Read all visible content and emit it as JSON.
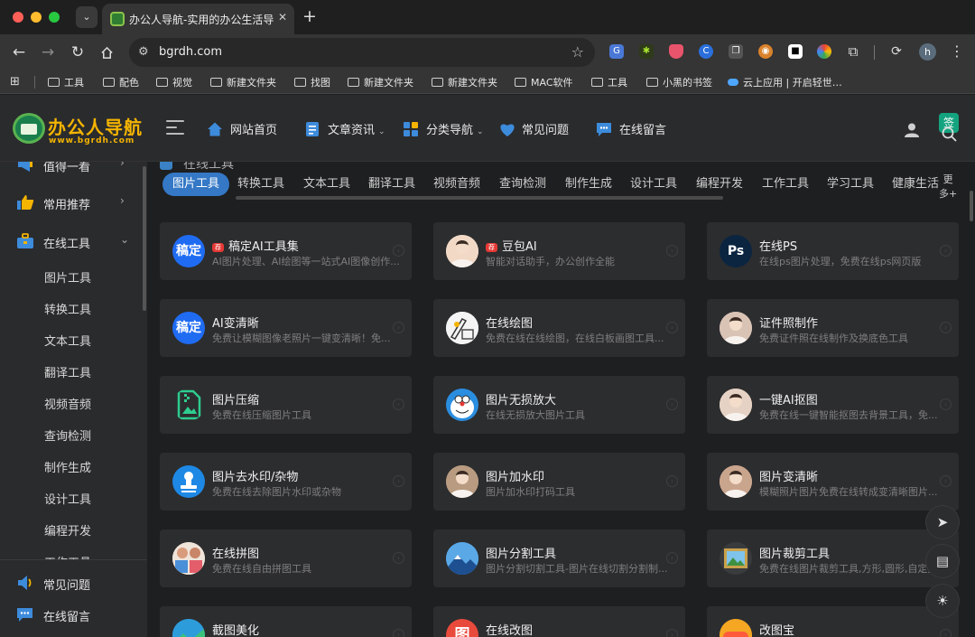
{
  "browser": {
    "tab_title": "办公人导航-实用的办公生活导航",
    "tab_close": "✕",
    "new_tab": "+",
    "url": "bgrdh.com",
    "profile_initial": "h",
    "bookmarks": [
      {
        "label": "工具",
        "kind": "folder"
      },
      {
        "label": "配色",
        "kind": "folder"
      },
      {
        "label": "视觉",
        "kind": "folder"
      },
      {
        "label": "新建文件夹",
        "kind": "folder"
      },
      {
        "label": "找图",
        "kind": "folder"
      },
      {
        "label": "新建文件夹",
        "kind": "folder"
      },
      {
        "label": "新建文件夹",
        "kind": "folder"
      },
      {
        "label": "MAC软件",
        "kind": "folder"
      },
      {
        "label": "工具",
        "kind": "folder"
      },
      {
        "label": "小黑的书签",
        "kind": "folder"
      },
      {
        "label": "云上应用 | 开启轻世…",
        "kind": "cloud"
      }
    ]
  },
  "site": {
    "logo_title": "办公人导航",
    "logo_url": "www.bgrdh.com",
    "badge_text": "签",
    "nav": [
      {
        "label": "网站首页",
        "icon": "home-icon",
        "color": "#3d8bdb",
        "caret": false
      },
      {
        "label": "文章资讯",
        "icon": "document-icon",
        "color": "#3d8bdb",
        "caret": true
      },
      {
        "label": "分类导航",
        "icon": "grid-icon",
        "color": "#3d8bdb",
        "caret": true
      },
      {
        "label": "常见问题",
        "icon": "heart-hand-icon",
        "color": "#3d8bdb",
        "caret": false
      },
      {
        "label": "在线留言",
        "icon": "chat-icon",
        "color": "#3d8bdb",
        "caret": false
      }
    ]
  },
  "sidebar": {
    "top_items": [
      {
        "label": "值得一看",
        "icon": "megaphone-icon",
        "arrow": "›"
      },
      {
        "label": "常用推荐",
        "icon": "thumbs-up-icon",
        "arrow": "›"
      },
      {
        "label": "在线工具",
        "icon": "toolbox-icon",
        "arrow": "⌄"
      }
    ],
    "sub_items": [
      "图片工具",
      "转换工具",
      "文本工具",
      "翻译工具",
      "视频音频",
      "查询检测",
      "制作生成",
      "设计工具",
      "编程开发",
      "工作工具"
    ],
    "bottom_items": [
      {
        "label": "常见问题",
        "icon": "speaker-icon"
      },
      {
        "label": "在线留言",
        "icon": "chat-icon"
      }
    ]
  },
  "main": {
    "section_title": "在线工具",
    "tabs": [
      "图片工具",
      "转换工具",
      "文本工具",
      "翻译工具",
      "视频音频",
      "查询检测",
      "制作生成",
      "设计工具",
      "编程开发",
      "工作工具",
      "学习工具",
      "健康生活"
    ],
    "active_tab": 0,
    "more_line1": "更",
    "more_line2": "多+",
    "hot_label": "荐",
    "cards": [
      {
        "title": "稿定AI工具集",
        "desc": "AI图片处理、AI绘图等一站式AI图像创作...",
        "hot": true,
        "icon": "gaoding-logo-icon",
        "icon_text": "稿定",
        "color": "#1f6cf3"
      },
      {
        "title": "豆包AI",
        "desc": "智能对话助手，办公创作全能",
        "hot": true,
        "icon": "doubao-avatar-icon",
        "icon_text": "",
        "color": "#f1d9c6"
      },
      {
        "title": "在线PS",
        "desc": "在线ps图片处理，免费在线ps网页版",
        "hot": false,
        "icon": "photoshop-icon",
        "icon_text": "Ps",
        "color": "#0b2540"
      },
      {
        "title": "AI变清晰",
        "desc": "免费让模糊图像老照片一键变清晰！免...",
        "hot": false,
        "icon": "gaoding-logo-icon",
        "icon_text": "稿定",
        "color": "#1f6cf3"
      },
      {
        "title": "在线绘图",
        "desc": "免费在线在线绘图，在线白板画图工具...",
        "hot": false,
        "icon": "drawing-hand-icon",
        "icon_text": "",
        "color": "#f2f2f2"
      },
      {
        "title": "证件照制作",
        "desc": "免费证件照在线制作及换底色工具",
        "hot": false,
        "icon": "portrait-girl-icon",
        "icon_text": "",
        "color": "#d9c3b5"
      },
      {
        "title": "图片压缩",
        "desc": "免费在线压缩图片工具",
        "hot": false,
        "icon": "image-compress-icon",
        "icon_text": "",
        "color": "#2c2d2f"
      },
      {
        "title": "图片无损放大",
        "desc": "在线无损放大图片工具",
        "hot": false,
        "icon": "doraemon-icon",
        "icon_text": "",
        "color": "#2a8ee0"
      },
      {
        "title": "一键AI抠图",
        "desc": "免费在线一键智能抠图去背景工具，免...",
        "hot": false,
        "icon": "portrait-woman-icon",
        "icon_text": "",
        "color": "#e6d2c4"
      },
      {
        "title": "图片去水印/杂物",
        "desc": "免费在线去除图片水印或杂物",
        "hot": false,
        "icon": "stamp-icon",
        "icon_text": "",
        "color": "#1e88e5"
      },
      {
        "title": "图片加水印",
        "desc": "图片加水印打码工具",
        "hot": false,
        "icon": "portrait-man-icon",
        "icon_text": "",
        "color": "#b89b80"
      },
      {
        "title": "图片变清晰",
        "desc": "模糊照片图片免费在线转成变清晰图片...",
        "hot": false,
        "icon": "portrait-lady-icon",
        "icon_text": "",
        "color": "#caa58d"
      },
      {
        "title": "在线拼图",
        "desc": "免费在线自由拼图工具",
        "hot": false,
        "icon": "collage-icon",
        "icon_text": "",
        "color": "#d8c6b8"
      },
      {
        "title": "图片分割工具",
        "desc": "图片分割切割工具-图片在线切割分割制...",
        "hot": false,
        "icon": "mountain-image-icon",
        "icon_text": "",
        "color": "#2f7bd1"
      },
      {
        "title": "图片裁剪工具",
        "desc": "免费在线图片裁剪工具,方形,圆形,自定义...",
        "hot": false,
        "icon": "framed-picture-icon",
        "icon_text": "",
        "color": "#3a3b3d"
      },
      {
        "title": "截图美化",
        "desc": "",
        "hot": false,
        "icon": "screenshot-icon",
        "icon_text": "",
        "color": "#2d9cdb"
      },
      {
        "title": "在线改图",
        "desc": "",
        "hot": false,
        "icon": "edit-image-icon",
        "icon_text": "图",
        "color": "#e84a3c"
      },
      {
        "title": "改图宝",
        "desc": "",
        "hot": false,
        "icon": "gaitubao-icon",
        "icon_text": "",
        "color": "#f5a623"
      }
    ]
  }
}
